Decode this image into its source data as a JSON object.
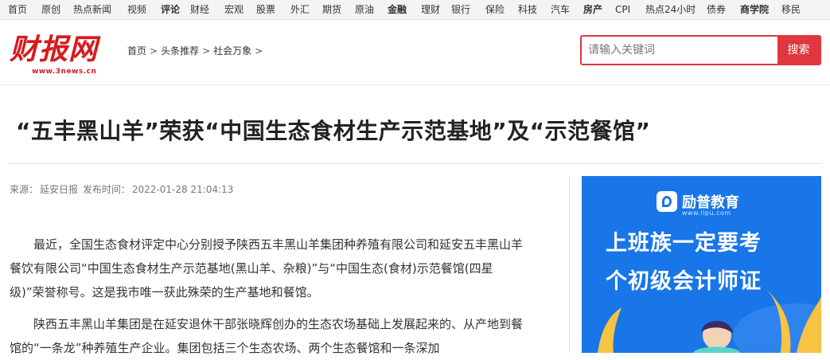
{
  "topnav": {
    "items": [
      {
        "label": "首页",
        "bold": false
      },
      {
        "label": "原创",
        "bold": false
      },
      {
        "label": "热点新闻",
        "bold": false
      },
      {
        "label": "视频",
        "bold": false
      },
      {
        "label": "评论",
        "bold": true
      },
      {
        "label": "财经",
        "bold": false
      },
      {
        "label": "宏观",
        "bold": false
      },
      {
        "label": "股票",
        "bold": false
      },
      {
        "label": "外汇",
        "bold": false
      },
      {
        "label": "期货",
        "bold": false
      },
      {
        "label": "原油",
        "bold": false
      },
      {
        "label": "金融",
        "bold": true
      },
      {
        "label": "理财",
        "bold": false
      },
      {
        "label": "银行",
        "bold": false
      },
      {
        "label": "保险",
        "bold": false
      },
      {
        "label": "科技",
        "bold": false
      },
      {
        "label": "汽车",
        "bold": false
      },
      {
        "label": "房产",
        "bold": true
      },
      {
        "label": "CPI",
        "bold": false
      },
      {
        "label": "热点24小时",
        "bold": false
      },
      {
        "label": "债券",
        "bold": false
      },
      {
        "label": "商学院",
        "bold": true
      },
      {
        "label": "移民",
        "bold": false
      }
    ]
  },
  "header": {
    "logo_text": "财报网",
    "logo_url": "www.3news.cn",
    "breadcrumb": [
      "首页",
      "头条推荐",
      "社会万象"
    ],
    "breadcrumb_sep": ">",
    "search_placeholder": "请输入关键词",
    "search_button": "搜索"
  },
  "article": {
    "title": "“五丰黑山羊”荣获“中国生态食材生产示范基地”及“示范餐馆”",
    "source_label": "来源：",
    "source": "延安日报",
    "publish_label": "发布时间：",
    "publish_time": "2022-01-28 21:04:13",
    "paragraphs": [
      "最近，全国生态食材评定中心分别授予陕西五丰黑山羊集团种养殖有限公司和延安五丰黑山羊餐饮有限公司“中国生态食材生产示范基地(黑山羊、杂粮)”与“中国生态(食材)示范餐馆(四星级)”荣誉称号。这是我市唯一获此殊荣的生产基地和餐馆。",
      "陕西五丰黑山羊集团是在延安退休干部张晓辉创办的生态农场基础上发展起来的、从产地到餐馆的“一条龙”种养殖生产企业。集团包括三个生态农场、两个生态餐馆和一条深加"
    ]
  },
  "ad": {
    "brand": "励普教育",
    "url": "www.lipu.com",
    "line1": "上班族一定要考",
    "line2": "个初级会计师证",
    "bg_color": "#1976e8"
  },
  "colors": {
    "accent": "#e0363f",
    "logo": "#d8191d"
  }
}
